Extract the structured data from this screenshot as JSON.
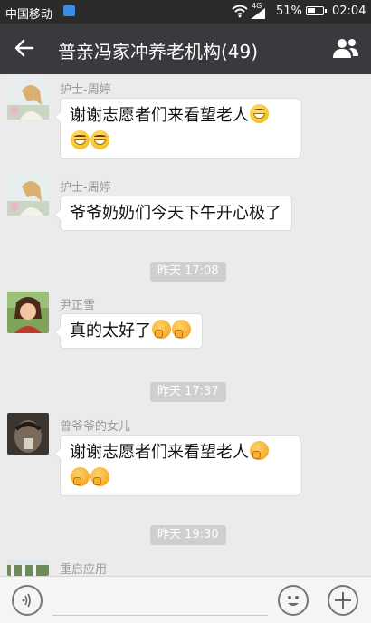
{
  "status_bar": {
    "carrier": "中国移动",
    "network": "4G",
    "battery_percent": "51%",
    "battery_level": 0.51,
    "time": "02:04"
  },
  "header": {
    "title": "普亲冯家冲养老机构(49)",
    "back_icon": "arrow-left-icon",
    "group_icon": "group-members-icon"
  },
  "messages": [
    {
      "sender": "护士-周婷",
      "text": "谢谢志愿者们来看望老人",
      "emoji": [
        "grin",
        "grin",
        "grin"
      ]
    },
    {
      "sender": "护士-周婷",
      "text": "爷爷奶奶们今天下午开心极了",
      "emoji": []
    },
    {
      "sender": "尹正雪",
      "text": "真的太好了",
      "emoji": [
        "shy",
        "shy"
      ]
    },
    {
      "sender": "曾爷爷的女儿",
      "text": "谢谢志愿者们来看望老人",
      "emoji": [
        "shy",
        "shy",
        "shy"
      ]
    },
    {
      "sender": "重启应用",
      "text": "",
      "emoji": []
    }
  ],
  "timestamps": [
    "昨天 17:08",
    "昨天 17:37",
    "昨天 19:30"
  ],
  "input_bar": {
    "voice_icon": "voice-icon",
    "emoji_icon": "emoji-icon",
    "plus_icon": "plus-icon",
    "input_value": ""
  },
  "colors": {
    "title_bar": "#393a3e",
    "status_bar": "#2b2b2b",
    "chat_bg": "#ebebeb",
    "timestamp_bg": "#cfcfcf"
  }
}
